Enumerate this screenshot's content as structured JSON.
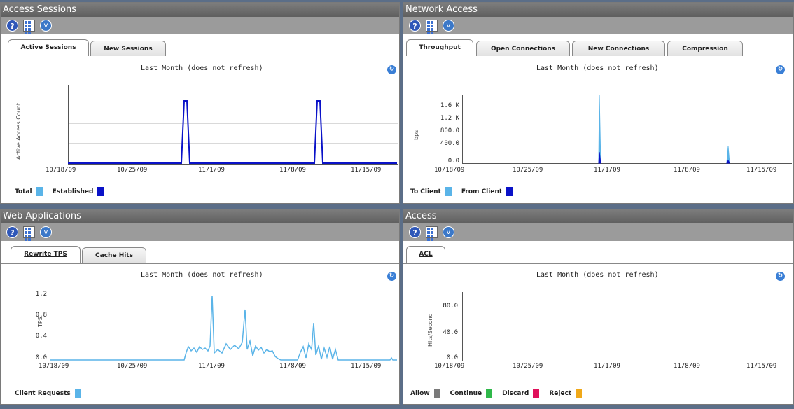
{
  "toolbar": {
    "help_glyph": "?",
    "menu_glyph": "v"
  },
  "panels": [
    {
      "title": "Access Sessions",
      "tabs": [
        "Active Sessions",
        "New Sessions"
      ],
      "chart_title": "Last Month (does not refresh)",
      "ylabel": "Active Access Count",
      "yticks": [
        "",
        "",
        ""
      ],
      "xticks": [
        "10/18/09",
        "10/25/09",
        "11/1/09",
        "11/8/09",
        "11/15/09"
      ],
      "legend": [
        {
          "label": "Total",
          "color": "#5ab4e8"
        },
        {
          "label": "Established",
          "color": "#0a12c8"
        }
      ]
    },
    {
      "title": "Network Access",
      "tabs": [
        "Throughput",
        "Open Connections",
        "New Connections",
        "Compression"
      ],
      "chart_title": "Last Month (does not refresh)",
      "ylabel": "bps",
      "yticks": [
        "1.6 K",
        "1.2 K",
        "800.0",
        "400.0",
        "0.0"
      ],
      "xticks": [
        "10/18/09",
        "10/25/09",
        "11/1/09",
        "11/8/09",
        "11/15/09"
      ],
      "legend": [
        {
          "label": "To Client",
          "color": "#5ab4e8"
        },
        {
          "label": "From Client",
          "color": "#0a12c8"
        }
      ]
    },
    {
      "title": "Web Applications",
      "tabs": [
        "Rewrite TPS",
        "Cache Hits"
      ],
      "chart_title": "Last Month (does not refresh)",
      "ylabel": "TPS",
      "yticks": [
        "1.2",
        "0.8",
        "0.4",
        "0.0"
      ],
      "xticks": [
        "10/18/09",
        "10/25/09",
        "11/1/09",
        "11/8/09",
        "11/15/09"
      ],
      "legend": [
        {
          "label": "Client Requests",
          "color": "#5ab4e8"
        }
      ]
    },
    {
      "title": "Access",
      "tabs": [
        "ACL"
      ],
      "chart_title": "Last Month (does not refresh)",
      "ylabel": "Hits/Second",
      "yticks": [
        "80.0",
        "40.0",
        "0.0"
      ],
      "xticks": [
        "10/18/09",
        "10/25/09",
        "11/1/09",
        "11/8/09",
        "11/15/09"
      ],
      "legend": [
        {
          "label": "Allow",
          "color": "#7a7a7a"
        },
        {
          "label": "Continue",
          "color": "#2fb84a"
        },
        {
          "label": "Discard",
          "color": "#e0105a"
        },
        {
          "label": "Reject",
          "color": "#f0a818"
        }
      ]
    }
  ],
  "chart_data": [
    {
      "type": "line",
      "x": [
        "10/18/09",
        "10/25/09",
        "11/1/09",
        "11/8/09",
        "11/15/09"
      ],
      "series": [
        {
          "name": "Established",
          "points": [
            [
              "10/18/09",
              0
            ],
            [
              "10/28/09",
              0
            ],
            [
              "10/28/09",
              1
            ],
            [
              "10/29/09",
              0
            ],
            [
              "11/5/09",
              0
            ],
            [
              "11/5/09",
              1
            ],
            [
              "11/6/09",
              0
            ],
            [
              "11/15/09",
              0
            ]
          ]
        }
      ]
    },
    {
      "type": "area",
      "series": [
        {
          "name": "To Client",
          "points": [
            [
              "10/31/09",
              1850
            ],
            [
              "11/10/09",
              400
            ]
          ]
        },
        {
          "name": "From Client",
          "points": [
            [
              "10/31/09",
              250
            ]
          ]
        }
      ],
      "ylim": [
        0,
        1900
      ]
    },
    {
      "type": "line",
      "series": [
        {
          "name": "Client Requests",
          "points": [
            [
              "10/28/09",
              0.15
            ],
            [
              "10/29/09",
              0.25
            ],
            [
              "10/30/09",
              0.2
            ],
            [
              "10/31/09",
              0.25
            ],
            [
              "11/1/09",
              1.25
            ],
            [
              "11/1/09",
              0.2
            ],
            [
              "11/2/09",
              0.28
            ],
            [
              "11/3/09",
              0.3
            ],
            [
              "11/3/09",
              0.95
            ],
            [
              "11/4/09",
              0.25
            ],
            [
              "11/5/09",
              0.3
            ],
            [
              "11/6/09",
              0.15
            ],
            [
              "11/7/09",
              0.1
            ],
            [
              "11/8/09",
              0.2
            ],
            [
              "11/9/09",
              0.35
            ],
            [
              "11/10/09",
              0.75
            ],
            [
              "11/10/09",
              0.1
            ],
            [
              "11/11/09",
              0.3
            ],
            [
              "11/12/09",
              0.0
            ]
          ]
        }
      ],
      "ylim": [
        0,
        1.3
      ]
    },
    {
      "type": "line",
      "series": [
        {
          "name": "Allow",
          "points": []
        },
        {
          "name": "Continue",
          "points": []
        },
        {
          "name": "Discard",
          "points": []
        },
        {
          "name": "Reject",
          "points": []
        }
      ],
      "ylim": [
        0,
        100
      ]
    }
  ]
}
